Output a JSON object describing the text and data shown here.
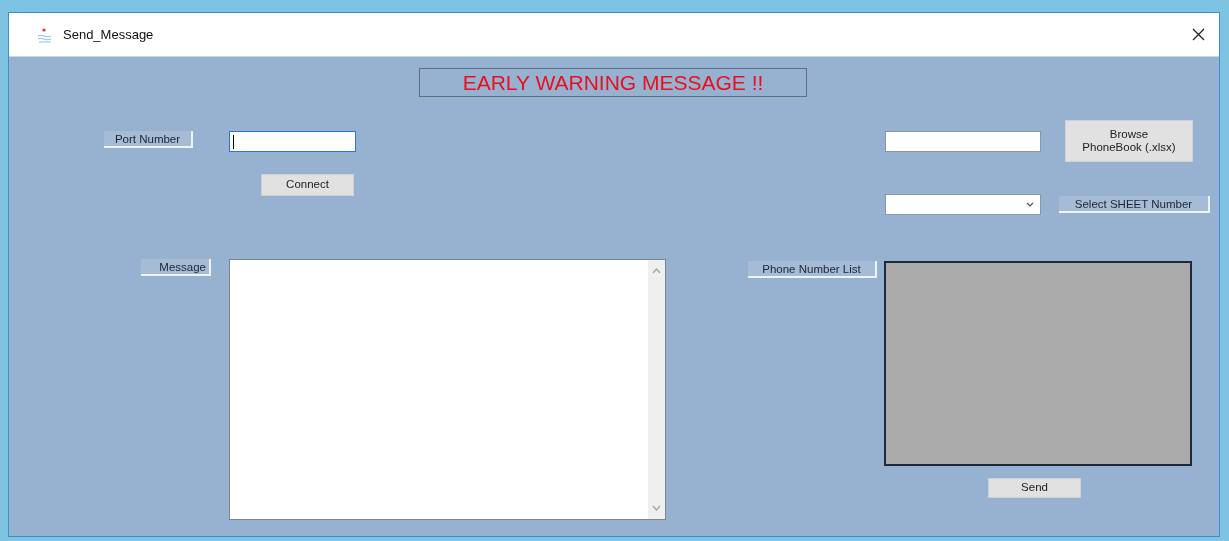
{
  "window": {
    "title": "Send_Message"
  },
  "banner": "EARLY WARNING MESSAGE !!",
  "port": {
    "label": "Port Number",
    "focused": true
  },
  "connect_button": "Connect",
  "message": {
    "label": "Message"
  },
  "phonebook": {
    "browse_button": [
      "Browse",
      "PhoneBook (.xlsx)"
    ]
  },
  "sheet": {
    "label": "Select SHEET Number"
  },
  "phone_list": {
    "label": "Phone Number List"
  },
  "send_button": "Send"
}
